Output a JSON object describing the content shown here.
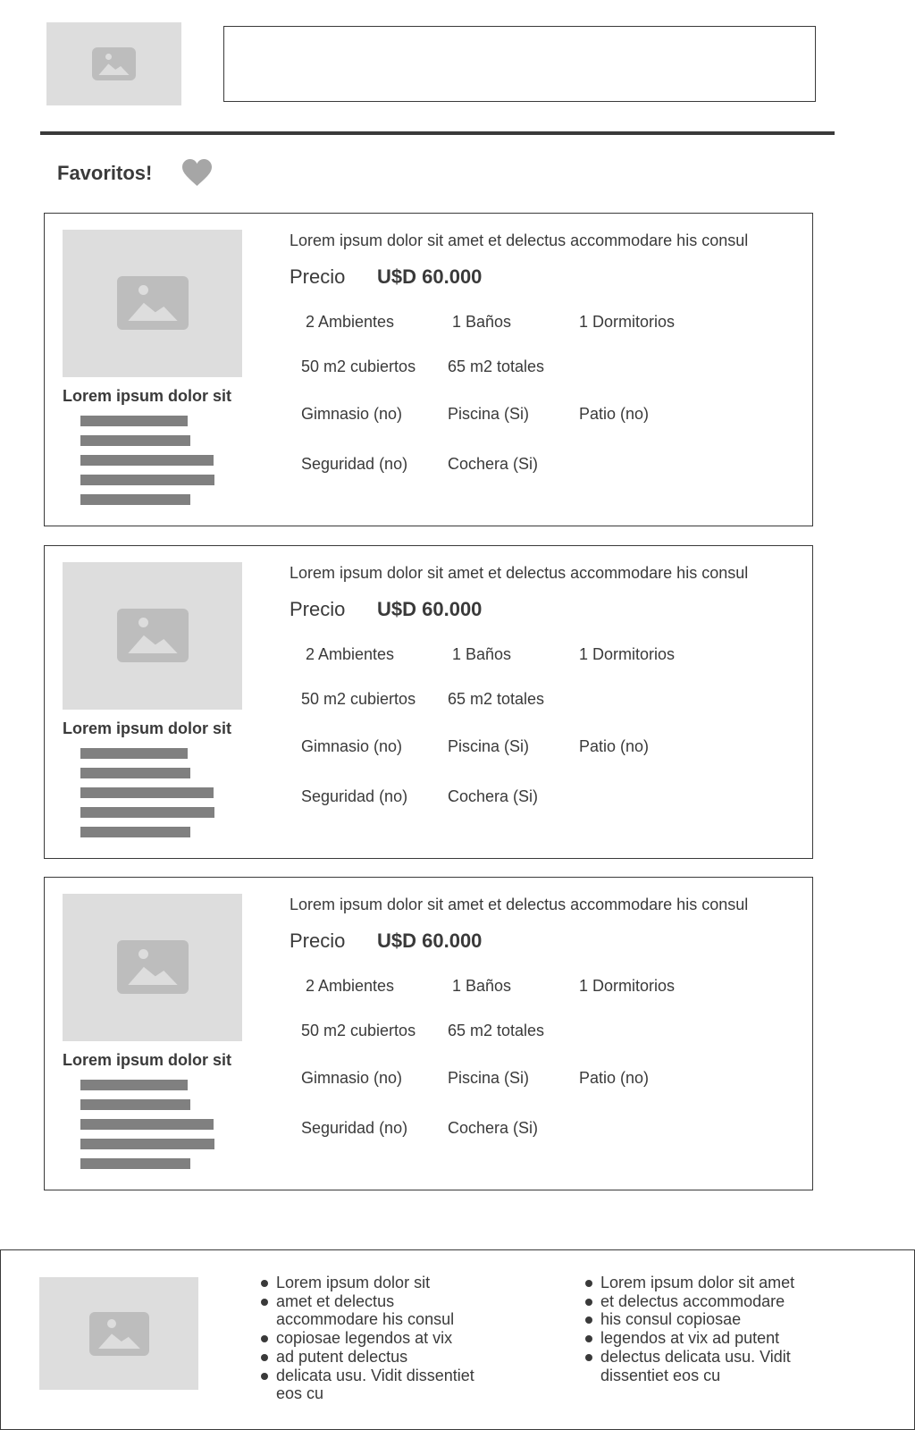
{
  "header": {
    "logo_icon": "image-placeholder-icon",
    "search_value": ""
  },
  "favorites": {
    "title": "Favoritos!",
    "heart_icon": "heart-icon",
    "heart_color": "#a6a6a6"
  },
  "cards": [
    {
      "image_icon": "image-placeholder-icon",
      "name": "Lorem ipsum dolor sit",
      "description": "Lorem ipsum dolor sit amet et delectus accommodare his consul",
      "price_label": "Precio",
      "price_value": "U$D 60.000",
      "ambientes": "2 Ambientes",
      "banos": "1 Baños",
      "dormitorios": "1 Dormitorios",
      "cubiertos": "50 m2 cubiertos",
      "totales": "65 m2 totales",
      "gimnasio": "Gimnasio (no)",
      "piscina": "Piscina (Si)",
      "patio": "Patio (no)",
      "seguridad": "Seguridad (no)",
      "cochera": "Cochera (Si)"
    },
    {
      "image_icon": "image-placeholder-icon",
      "name": "Lorem ipsum dolor sit",
      "description": "Lorem ipsum dolor sit amet et delectus accommodare his consul",
      "price_label": "Precio",
      "price_value": "U$D 60.000",
      "ambientes": "2 Ambientes",
      "banos": "1 Baños",
      "dormitorios": "1 Dormitorios",
      "cubiertos": "50 m2 cubiertos",
      "totales": "65 m2 totales",
      "gimnasio": "Gimnasio (no)",
      "piscina": "Piscina (Si)",
      "patio": "Patio (no)",
      "seguridad": "Seguridad (no)",
      "cochera": "Cochera (Si)"
    },
    {
      "image_icon": "image-placeholder-icon",
      "name": "Lorem ipsum dolor sit",
      "description": "Lorem ipsum dolor sit amet et delectus accommodare his consul",
      "price_label": "Precio",
      "price_value": "U$D 60.000",
      "ambientes": "2 Ambientes",
      "banos": "1 Baños",
      "dormitorios": "1 Dormitorios",
      "cubiertos": "50 m2 cubiertos",
      "totales": "65 m2 totales",
      "gimnasio": "Gimnasio (no)",
      "piscina": "Piscina (Si)",
      "patio": "Patio (no)",
      "seguridad": "Seguridad (no)",
      "cochera": "Cochera (Si)"
    }
  ],
  "footer": {
    "logo_icon": "image-placeholder-icon",
    "list_a": [
      "Lorem ipsum dolor sit",
      "amet et delectus accommodare his consul",
      "copiosae legendos at vix",
      "ad putent delectus",
      "delicata usu. Vidit dissentiet eos cu"
    ],
    "list_b": [
      "Lorem ipsum dolor sit amet",
      "et delectus accommodare",
      "his consul copiosae",
      "legendos at vix ad putent",
      "delectus delicata usu. Vidit dissentiet eos cu"
    ]
  },
  "colors": {
    "text": "#3a3a3a",
    "placeholder_bg": "#dddddd",
    "placeholder_icon": "#bdbdbd",
    "text_bar": "#808080"
  }
}
